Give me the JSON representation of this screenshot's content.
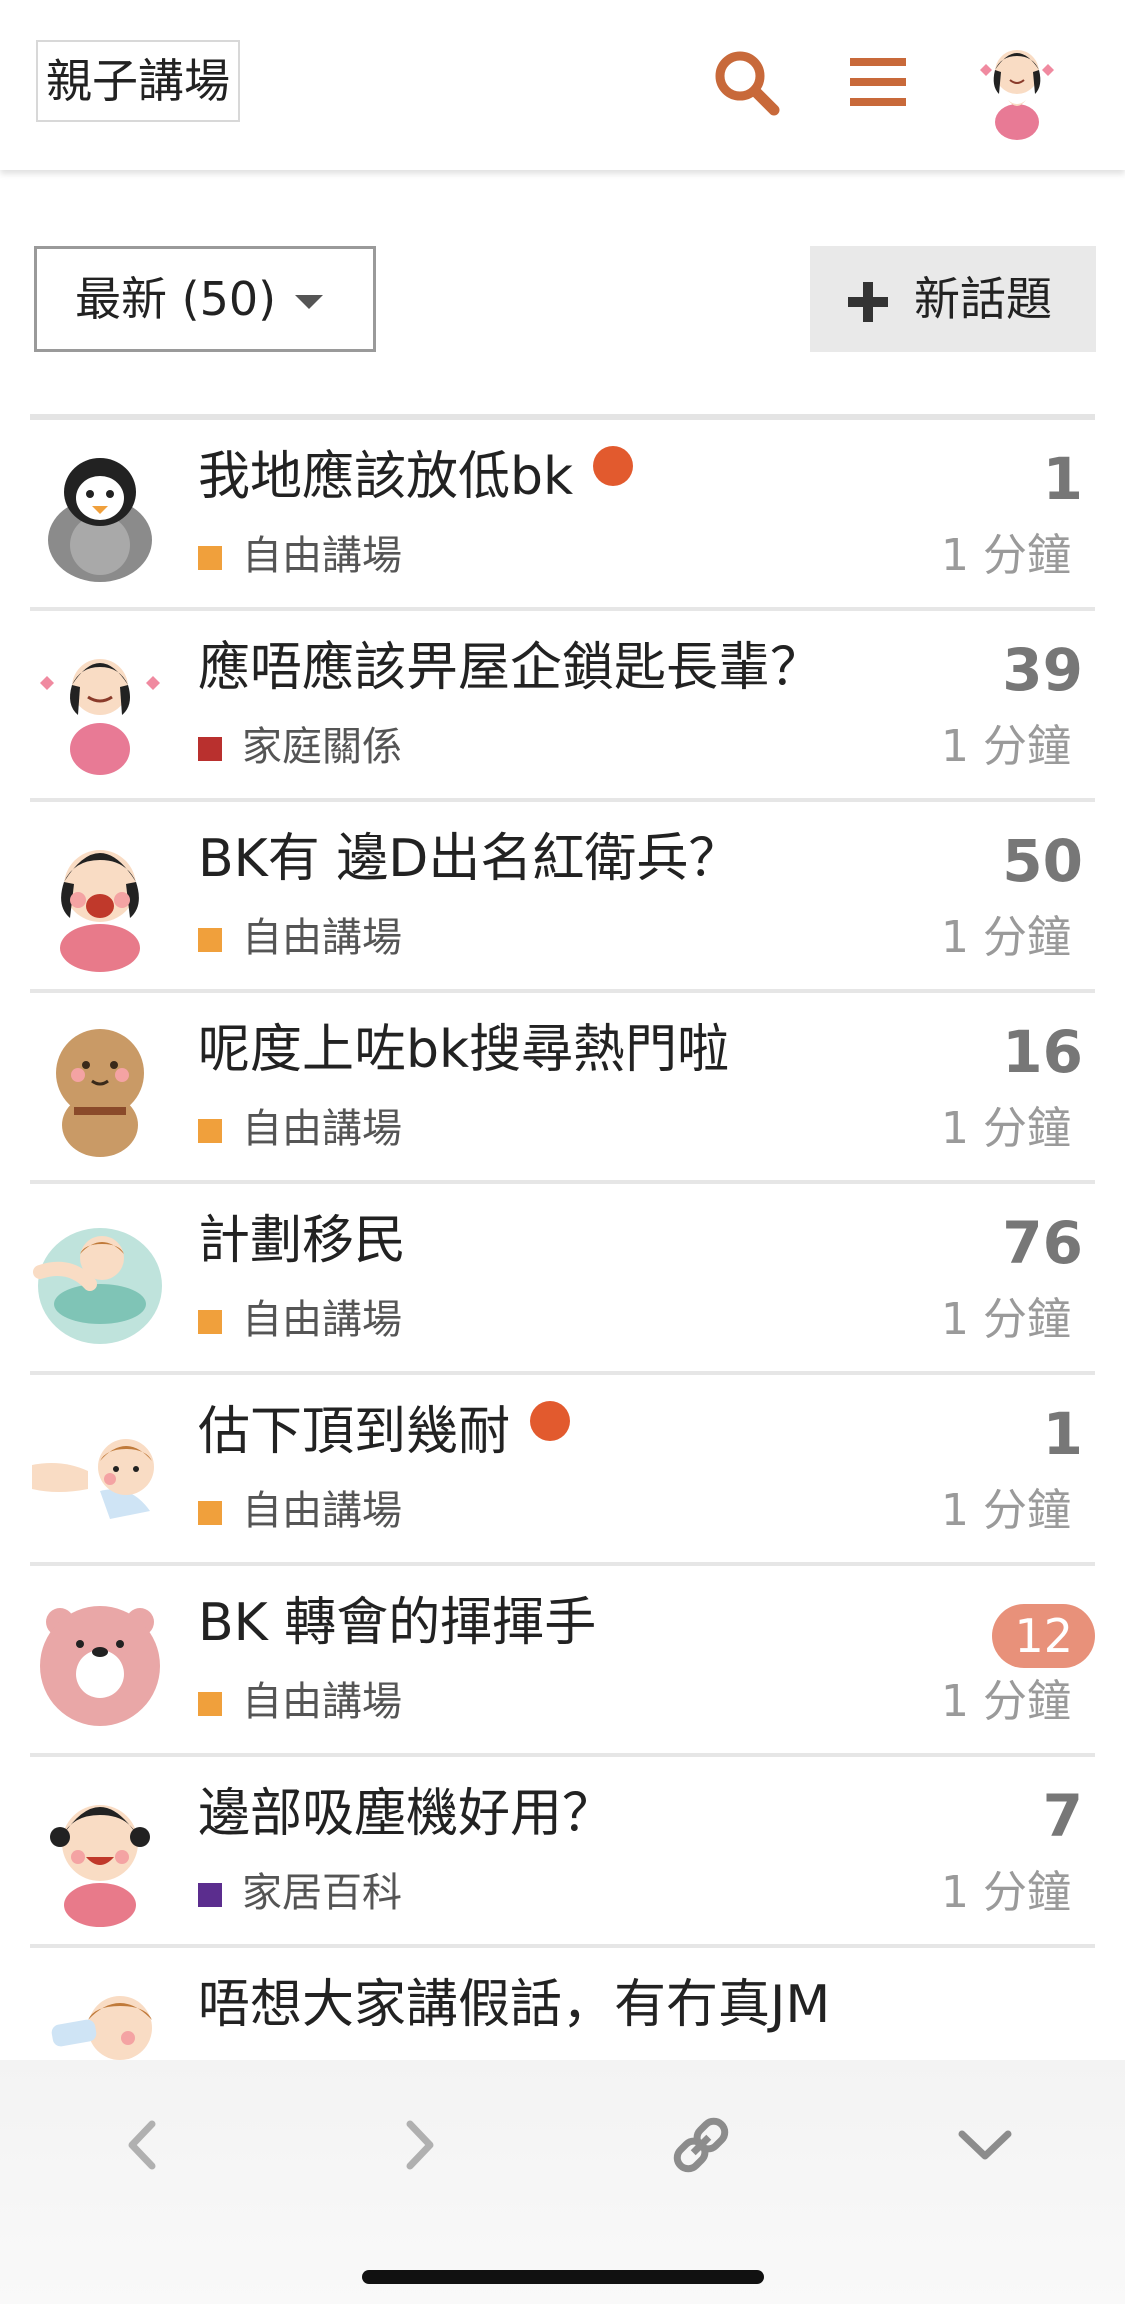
{
  "header": {
    "logo_text": "親子講場",
    "icons": [
      "search-icon",
      "menu-icon",
      "user-avatar"
    ],
    "accent_color": "#c8693a"
  },
  "controls": {
    "filter_label": "最新 (50)",
    "new_topic_label": "新話題"
  },
  "topics": [
    {
      "title": "我地應該放低bk",
      "unread_dot": true,
      "category": "自由講場",
      "category_color": "#f0a03c",
      "count": "1",
      "count_style": "plain",
      "age": "1 分鐘"
    },
    {
      "title": "應唔應該畀屋企鎖匙長輩？",
      "unread_dot": false,
      "category": "家庭關係",
      "category_color": "#b9302e",
      "count": "39",
      "count_style": "plain",
      "age": "1 分鐘"
    },
    {
      "title": "BK有 邊D出名紅衛兵？",
      "unread_dot": false,
      "category": "自由講場",
      "category_color": "#f0a03c",
      "count": "50",
      "count_style": "plain",
      "age": "1 分鐘"
    },
    {
      "title": "呢度上咗bk搜尋熱門啦",
      "unread_dot": false,
      "category": "自由講場",
      "category_color": "#f0a03c",
      "count": "16",
      "count_style": "plain",
      "age": "1 分鐘"
    },
    {
      "title": "計劃移民",
      "unread_dot": false,
      "category": "自由講場",
      "category_color": "#f0a03c",
      "count": "76",
      "count_style": "plain",
      "age": "1 分鐘"
    },
    {
      "title": "估下頂到幾耐",
      "unread_dot": true,
      "category": "自由講場",
      "category_color": "#f0a03c",
      "count": "1",
      "count_style": "plain",
      "age": "1 分鐘"
    },
    {
      "title": "BK 轉會的揮揮手",
      "unread_dot": false,
      "category": "自由講場",
      "category_color": "#f0a03c",
      "count": "12",
      "count_style": "badge",
      "age": "1 分鐘"
    },
    {
      "title": "邊部吸塵機好用？",
      "unread_dot": false,
      "category": "家居百科",
      "category_color": "#5b2d8e",
      "count": "7",
      "count_style": "plain",
      "age": "1 分鐘"
    },
    {
      "title": "唔想大家講假話，有冇真JM",
      "unread_dot": false,
      "category": "",
      "category_color": "",
      "count": "",
      "count_style": "plain",
      "age": ""
    }
  ],
  "toolbar": {
    "icons": [
      "back-icon",
      "forward-icon",
      "link-icon",
      "chevron-down-icon"
    ]
  }
}
